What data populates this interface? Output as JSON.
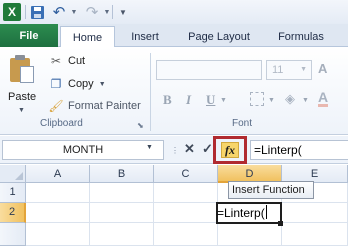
{
  "quick_access": {
    "app_icon": "excel-icon",
    "app_icon_glyph": "X",
    "icons": [
      "save-icon",
      "undo-icon",
      "redo-icon",
      "customize-icon"
    ]
  },
  "tabs": [
    {
      "label": "File",
      "active": false
    },
    {
      "label": "Home",
      "active": true
    },
    {
      "label": "Insert",
      "active": false
    },
    {
      "label": "Page Layout",
      "active": false
    },
    {
      "label": "Formulas",
      "active": false
    }
  ],
  "ribbon": {
    "clipboard": {
      "paste": "Paste",
      "cut": "Cut",
      "copy": "Copy",
      "format_painter": "Format Painter",
      "group_label": "Clipboard"
    },
    "font": {
      "font_name": "",
      "font_size": "11",
      "bold": "B",
      "italic": "I",
      "underline": "U",
      "font_color": "A",
      "group_label": "Font"
    }
  },
  "formula_bar": {
    "name_box": "MONTH",
    "formula": "=Linterp(",
    "fx_label": "fx",
    "tooltip": "Insert Function"
  },
  "grid": {
    "columns": [
      "A",
      "B",
      "C",
      "D",
      "E"
    ],
    "rows": [
      "1",
      "2"
    ],
    "active_column": "D",
    "active_row": "2",
    "active_cell_content": "=Linterp("
  },
  "colors": {
    "file_tab": "#217346",
    "highlight_box": "#b02a30",
    "active_header": "#f1c15f"
  }
}
